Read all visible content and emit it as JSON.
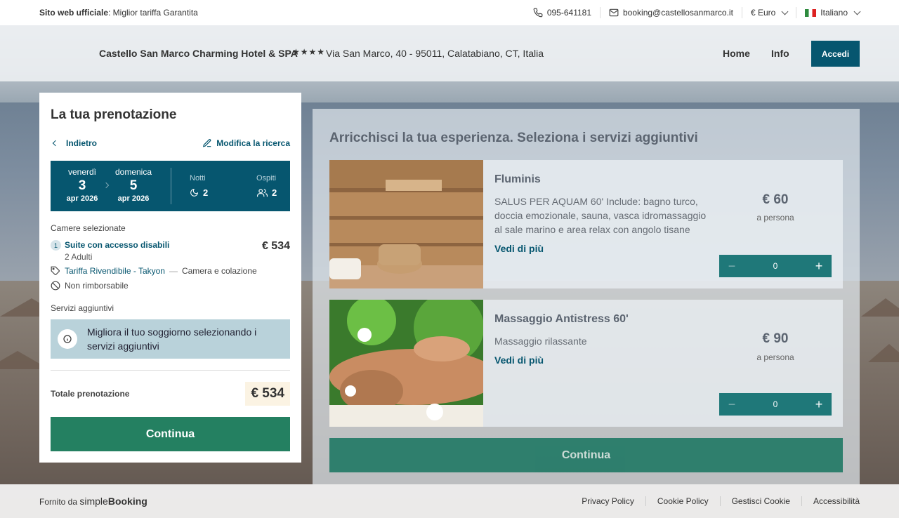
{
  "topbar": {
    "official_bold": "Sito web ufficiale",
    "official_rest": ": Miglior tariffa Garantita",
    "phone": "095-641181",
    "email": "booking@castellosanmarco.it",
    "currency": "€ Euro",
    "language": "Italiano"
  },
  "header": {
    "hotel_name": "Castello San Marco Charming Hotel & SPA",
    "stars": "★★★★",
    "address": "Via San Marco, 40 - 95011, Calatabiano, CT, Italia",
    "nav_home": "Home",
    "nav_info": "Info",
    "login": "Accedi"
  },
  "booking": {
    "title": "La tua prenotazione",
    "back": "Indietro",
    "edit": "Modifica la ricerca",
    "checkin": {
      "weekday": "venerdì",
      "day": "3",
      "month": "apr 2026"
    },
    "checkout": {
      "weekday": "domenica",
      "day": "5",
      "month": "apr 2026"
    },
    "nights_label": "Notti",
    "nights": "2",
    "guests_label": "Ospiti",
    "guests": "2",
    "rooms_label": "Camere selezionate",
    "room_index": "1",
    "room_name": "Suite con accesso disabili",
    "room_price": "€ 534",
    "room_adults": "2 Adulti",
    "rate_name": "Tariffa Rivendibile - Takyon",
    "rate_sep": "—",
    "board": "Camera e colazione",
    "refund": "Non rimborsabile",
    "extras_label": "Servizi aggiuntivi",
    "extras_info": "Migliora il tuo soggiorno selezionando i servizi aggiuntivi",
    "total_label": "Totale prenotazione",
    "total": "€ 534",
    "continue": "Continua"
  },
  "services": {
    "title": "Arricchisci la tua esperienza. Seleziona i servizi aggiuntivi",
    "items": [
      {
        "name": "Fluminis",
        "description": "SALUS PER AQUAM 60' Include: bagno turco, doccia emozionale, sauna, vasca idromassaggio al sale marino e area relax con angolo tisane",
        "more": "Vedi di più",
        "price": "€ 60",
        "per": "a persona",
        "qty": "0"
      },
      {
        "name": "Massaggio Antistress 60'",
        "description": "Massaggio rilassante",
        "more": "Vedi di più",
        "price": "€ 90",
        "per": "a persona",
        "qty": "0"
      }
    ],
    "continue": "Continua"
  },
  "footer": {
    "powered": "Fornito da",
    "brand_light": "simple",
    "brand_bold": "Booking",
    "links": [
      "Privacy Policy",
      "Cookie Policy",
      "Gestisci Cookie",
      "Accessibilità"
    ]
  }
}
